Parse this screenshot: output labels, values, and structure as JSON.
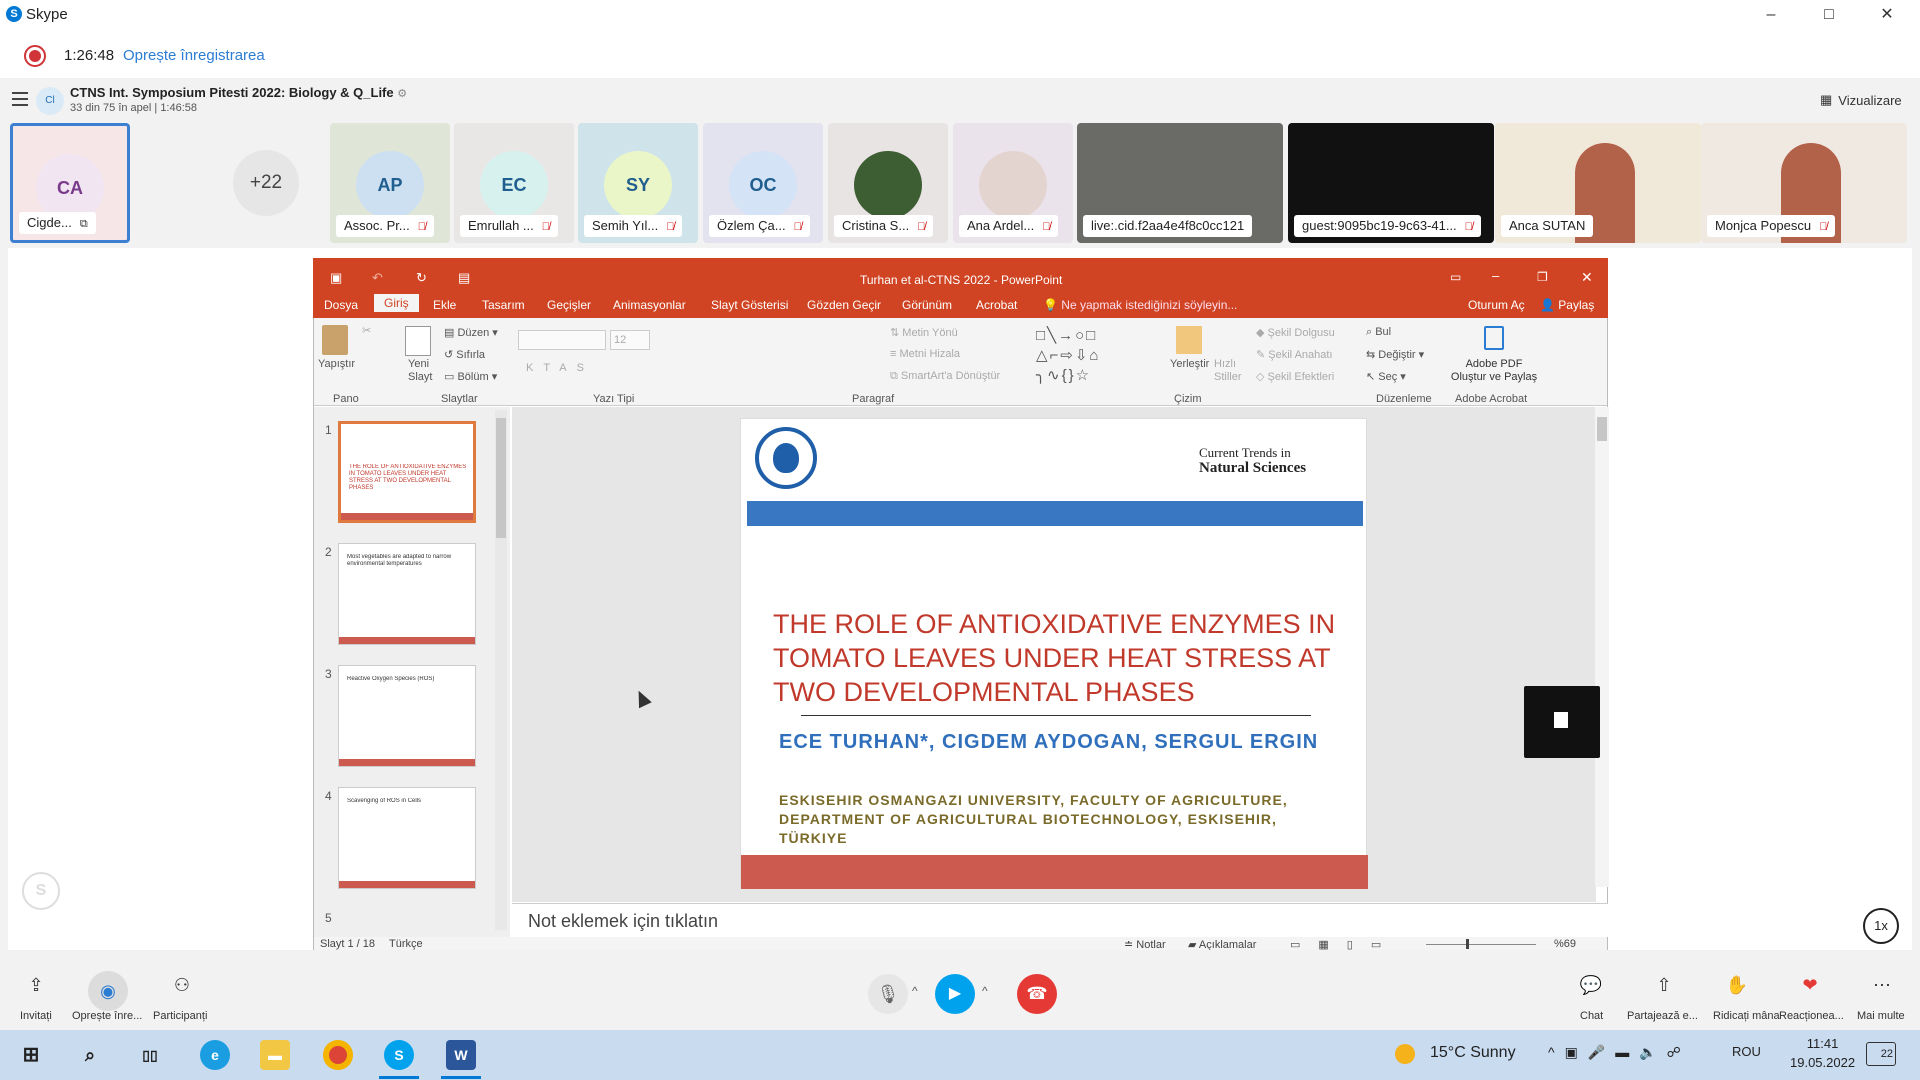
{
  "window": {
    "title": "Skype",
    "logo_letter": "S",
    "controls": {
      "minimize": "–",
      "maximize": "□",
      "close": "✕"
    }
  },
  "recording": {
    "time": "1:26:48",
    "stop_label": "Oprește înregistrarea"
  },
  "call": {
    "avatar": "Cl",
    "title": "CTNS Int. Symposium Pitesti 2022: Biology & Q_Life",
    "subtitle": "33 din 75 în apel | 1:46:58",
    "view_label": "Vizualizare"
  },
  "participants": {
    "self": {
      "initials": "CA",
      "name": "Cigde..."
    },
    "more_count": "+22",
    "tiles": [
      {
        "initials": "AP",
        "name": "Assoc. Pr...",
        "bg": "#dfe6d8",
        "av": "#cde0f2"
      },
      {
        "initials": "EC",
        "name": "Emrullah ...",
        "bg": "#e9e6e6",
        "av": "#d7f1ee"
      },
      {
        "initials": "SY",
        "name": "Semih Yıl...",
        "bg": "#cfe4ea",
        "av": "#eaf5c8"
      },
      {
        "initials": "OC",
        "name": "Özlem Ça...",
        "bg": "#e3e2ef",
        "av": "#d5e3f6"
      },
      {
        "initials": "",
        "name": "Cristina S...",
        "bg": "#e9e4e4",
        "av": "#3d5e33"
      },
      {
        "initials": "",
        "name": "Ana Ardel...",
        "bg": "#ebe3ec",
        "av": "#e4d4cf"
      },
      {
        "initials": "",
        "name": "live:.cid.f2aa4e4f8c0cc121",
        "bg": "#6a6a66",
        "av": ""
      },
      {
        "initials": "",
        "name": "guest:9095bc19-9c63-41...",
        "bg": "#111111",
        "av": ""
      },
      {
        "initials": "",
        "name": "Anca SUTAN",
        "bg": "#f0e8d8",
        "av": ""
      },
      {
        "initials": "",
        "name": "Monjca Popescu",
        "bg": "#efe9e2",
        "av": ""
      }
    ]
  },
  "powerpoint": {
    "title": "Turhan et al-CTNS 2022 - PowerPoint",
    "tabs": [
      "Dosya",
      "Giriş",
      "Ekle",
      "Tasarım",
      "Geçişler",
      "Animasyonlar",
      "Slayt Gösterisi",
      "Gözden Geçir",
      "Görünüm",
      "Acrobat"
    ],
    "search_hint": "Ne yapmak istediğinizi söyleyin...",
    "sign_in": "Oturum Aç",
    "share": "Paylaş",
    "ribbon": {
      "paste": "Yapıştır",
      "new_slide": "Yeni Slayt",
      "layout": "Düzen",
      "reset": "Sıfırla",
      "section": "Bölüm",
      "font_size": "12",
      "text_direction": "Metin Yönü",
      "align_text": "Metni Hizala",
      "smartart": "SmartArt'a Dönüştür",
      "arrange": "Yerleştir",
      "quick_styles": "Hızlı Stiller",
      "shape_fill": "Şekil Dolgusu",
      "shape_outline": "Şekil Anahatı",
      "shape_effects": "Şekil Efektleri",
      "find": "Bul",
      "replace": "Değiştir",
      "select": "Seç",
      "adobe": "Adobe PDF Oluştur ve Paylaş",
      "groups": [
        "Pano",
        "Slaytlar",
        "Yazı Tipi",
        "Paragraf",
        "Çizim",
        "Düzenleme",
        "Adobe Acrobat"
      ]
    },
    "thumbnails": [
      {
        "num": "1",
        "title": "THE ROLE OF ANTIOXIDATIVE ENZYMES IN TOMATO LEAVES UNDER HEAT STRESS AT TWO DEVELOPMENTAL PHASES"
      },
      {
        "num": "2",
        "title": "Most vegetables are adapted to narrow environmental temperatures"
      },
      {
        "num": "3",
        "title": "Reactive Oxygen Species (ROS)"
      },
      {
        "num": "4",
        "title": "Scavenging of ROS in Cells"
      },
      {
        "num": "5",
        "title": ""
      }
    ],
    "slide": {
      "publisher_line1": "Current Trends in",
      "publisher_line2": "Natural Sciences",
      "title": "THE ROLE OF ANTIOXIDATIVE ENZYMES IN TOMATO LEAVES UNDER HEAT STRESS AT TWO DEVELOPMENTAL PHASES",
      "authors": "ECE TURHAN*, CIGDEM AYDOGAN, SERGUL ERGIN",
      "affiliation": "ESKISEHIR OSMANGAZI UNIVERSITY, FACULTY OF AGRICULTURE, DEPARTMENT OF AGRICULTURAL BIOTECHNOLOGY, ESKISEHIR, TÜRKIYE"
    },
    "notes_placeholder": "Not eklemek için tıklatın",
    "status": {
      "slide": "Slayt 1 / 18",
      "language": "Türkçe",
      "notes": "Notlar",
      "comments": "Açıklamalar",
      "zoom": "%69"
    }
  },
  "speed": "1x",
  "bottom": {
    "invite": "Invitați",
    "stop_rec": "Oprește înre...",
    "participants": "Participanți",
    "chat": "Chat",
    "share": "Partajează e...",
    "raise": "Ridicați mâna",
    "react": "Reacționea...",
    "more": "Mai multe"
  },
  "taskbar": {
    "weather": "15°C  Sunny",
    "lang": "ROU",
    "time": "11:41",
    "date": "19.05.2022",
    "notif": "22"
  }
}
